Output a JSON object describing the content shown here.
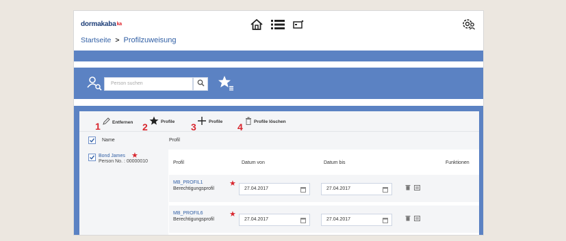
{
  "app": {
    "logo_text": "dormakaba",
    "logo_sub": "ka"
  },
  "breadcrumb": {
    "home": "Startseite",
    "separator": ">",
    "current": "Profilzuweisung"
  },
  "search": {
    "placeholder": "Person suchen"
  },
  "toolbar": {
    "remove_label": "Entfernen",
    "profile_star_label": "Profile",
    "profile_add_label": "Profile",
    "profile_delete_label": "Profile löschen",
    "markers": [
      "1",
      "2",
      "3",
      "4"
    ]
  },
  "table": {
    "col_name": "Name",
    "col_profile": "Profil"
  },
  "person": {
    "name": "Bond James",
    "number": "Person No. : 00000010"
  },
  "profile_table": {
    "headers": [
      "Profil",
      "Datum von",
      "Datum bis",
      "Funktionen"
    ],
    "rows": [
      {
        "name": "MB_PROFIL1",
        "type": "Berechtigungsprofil",
        "from": "27.04.2017",
        "to": "27.04.2017"
      },
      {
        "name": "MB_PROFIL6",
        "type": "Berechtigungsprofil",
        "from": "27.04.2017",
        "to": "27.04.2017"
      }
    ]
  },
  "colors": {
    "brand_blue": "#5b82c3",
    "link_blue": "#2f5ea4",
    "marker_red": "#d8262e"
  },
  "icons": [
    "home-icon",
    "list-icon",
    "card-icon",
    "settings-user-icon",
    "user-search-icon",
    "search-icon",
    "star-list-icon",
    "pencil-icon",
    "star-icon",
    "plus-icon",
    "trash-icon",
    "calendar-icon",
    "edit-icon"
  ]
}
